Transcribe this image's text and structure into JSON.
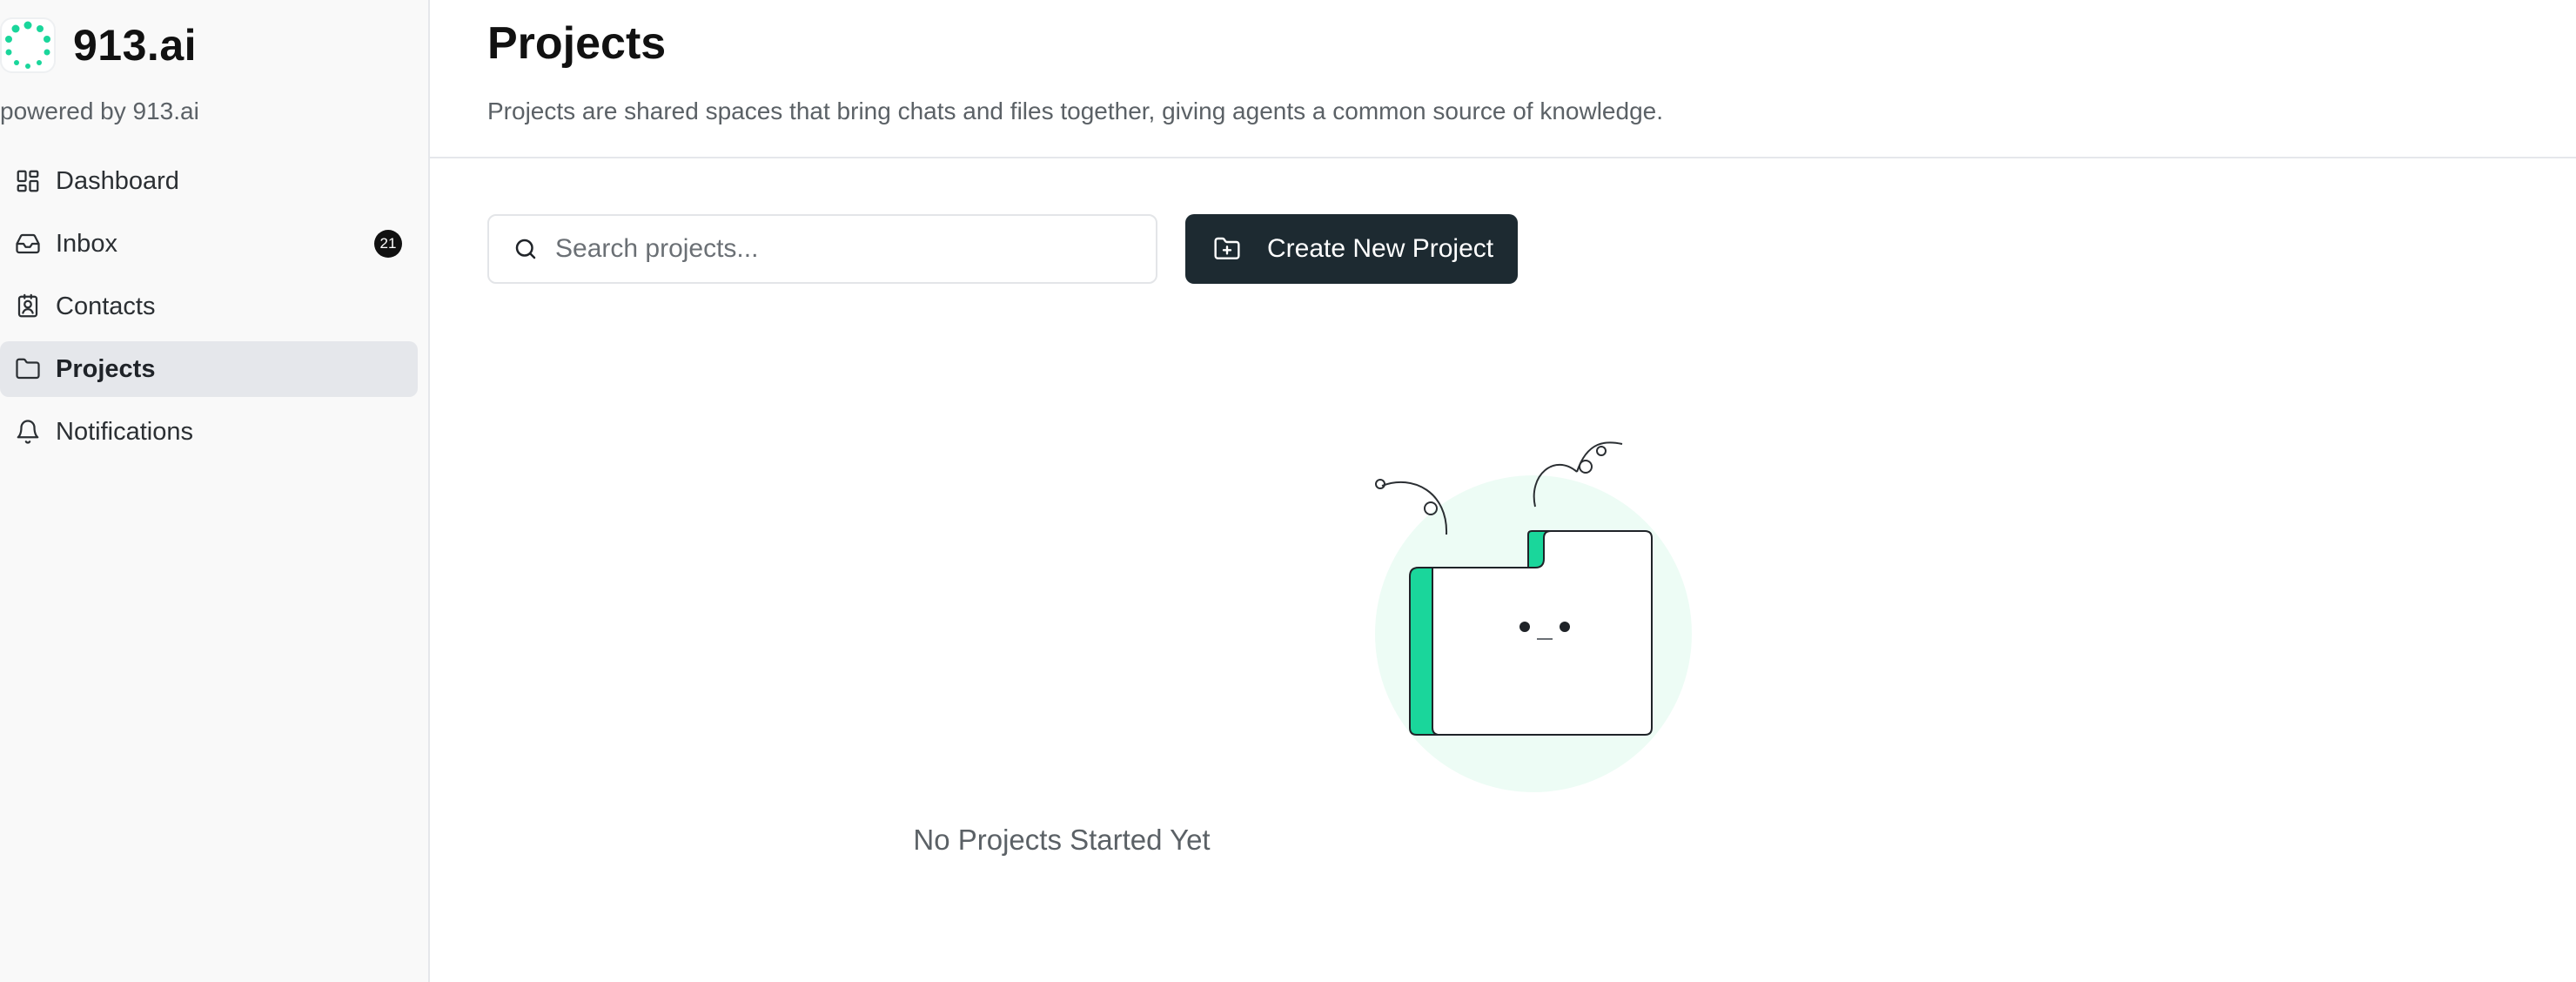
{
  "brand": {
    "name": "913.ai",
    "powered_by": "powered by 913.ai",
    "accent": "#1ad69b"
  },
  "sidebar": {
    "items": [
      {
        "label": "Dashboard",
        "icon": "dashboard-icon",
        "active": false
      },
      {
        "label": "Inbox",
        "icon": "inbox-icon",
        "active": false,
        "badge": "21"
      },
      {
        "label": "Contacts",
        "icon": "contacts-icon",
        "active": false
      },
      {
        "label": "Projects",
        "icon": "folder-icon",
        "active": true
      },
      {
        "label": "Notifications",
        "icon": "bell-icon",
        "active": false
      }
    ]
  },
  "header": {
    "title": "Projects",
    "subtitle": "Projects are shared spaces that bring chats and files together, giving agents a common source of knowledge."
  },
  "toolbar": {
    "search_placeholder": "Search projects...",
    "search_value": "",
    "create_label": "Create New Project",
    "button_color": "#1d2a31"
  },
  "empty_state": {
    "message": "No Projects Started Yet"
  }
}
